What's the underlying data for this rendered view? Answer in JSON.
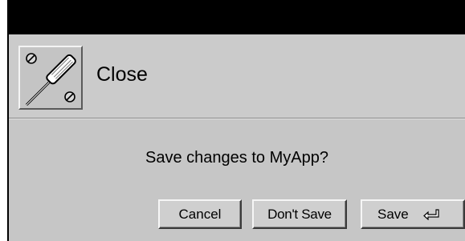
{
  "dialog": {
    "title": "Close",
    "app_icon": "screwdriver-tool-icon",
    "message": "Save changes to MyApp?",
    "buttons": {
      "cancel": "Cancel",
      "dont_save": "Don't Save",
      "save": "Save",
      "save_icon": "enter-return-icon"
    }
  },
  "colors": {
    "dialog_bg": "#c6c6c6",
    "titlebar": "#000000"
  }
}
